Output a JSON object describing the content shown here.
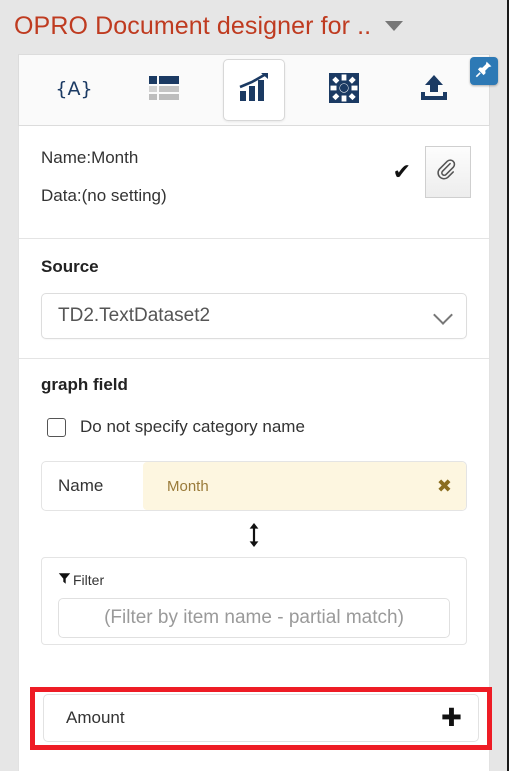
{
  "window": {
    "title": "OPRO Document designer for ..",
    "title_color": "#bf3b20",
    "caret_icon": "chevron-down-icon",
    "pin_icon": "pushpin-icon"
  },
  "toolbar": {
    "tabs": [
      {
        "icon": "braces-a-icon",
        "name": "field-code-tab",
        "active": false
      },
      {
        "icon": "table-icon",
        "name": "table-tab",
        "active": false
      },
      {
        "icon": "bar-chart-icon",
        "name": "chart-tab",
        "active": true
      },
      {
        "icon": "gear-icon",
        "name": "settings-tab",
        "active": false
      },
      {
        "icon": "upload-icon",
        "name": "upload-tab",
        "active": false
      }
    ]
  },
  "header_card": {
    "name_line": "Name:Month",
    "data_line": "Data:(no setting)",
    "check_icon": "checkmark-icon",
    "clip_icon": "paperclip-icon"
  },
  "source": {
    "label": "Source",
    "selected": "TD2.TextDataset2",
    "caret_icon": "chevron-down-icon"
  },
  "graph_field": {
    "label": "graph field",
    "checkbox": {
      "label": "Do not specify category name",
      "checked": false
    },
    "name_row": {
      "label": "Name",
      "value": "Month",
      "clear_icon": "close-x-icon",
      "chip_bg": "#fdf6e0",
      "chip_text_color": "#9a7b3a"
    },
    "drag_handle_icon": "vertical-resize-arrow-icon",
    "filter": {
      "icon": "funnel-icon",
      "label": "Filter",
      "placeholder": "(Filter by item name - partial match)",
      "value": ""
    },
    "amount_row": {
      "label": "Amount",
      "add_icon": "plus-icon",
      "highlight_color": "#ee1c25"
    }
  }
}
